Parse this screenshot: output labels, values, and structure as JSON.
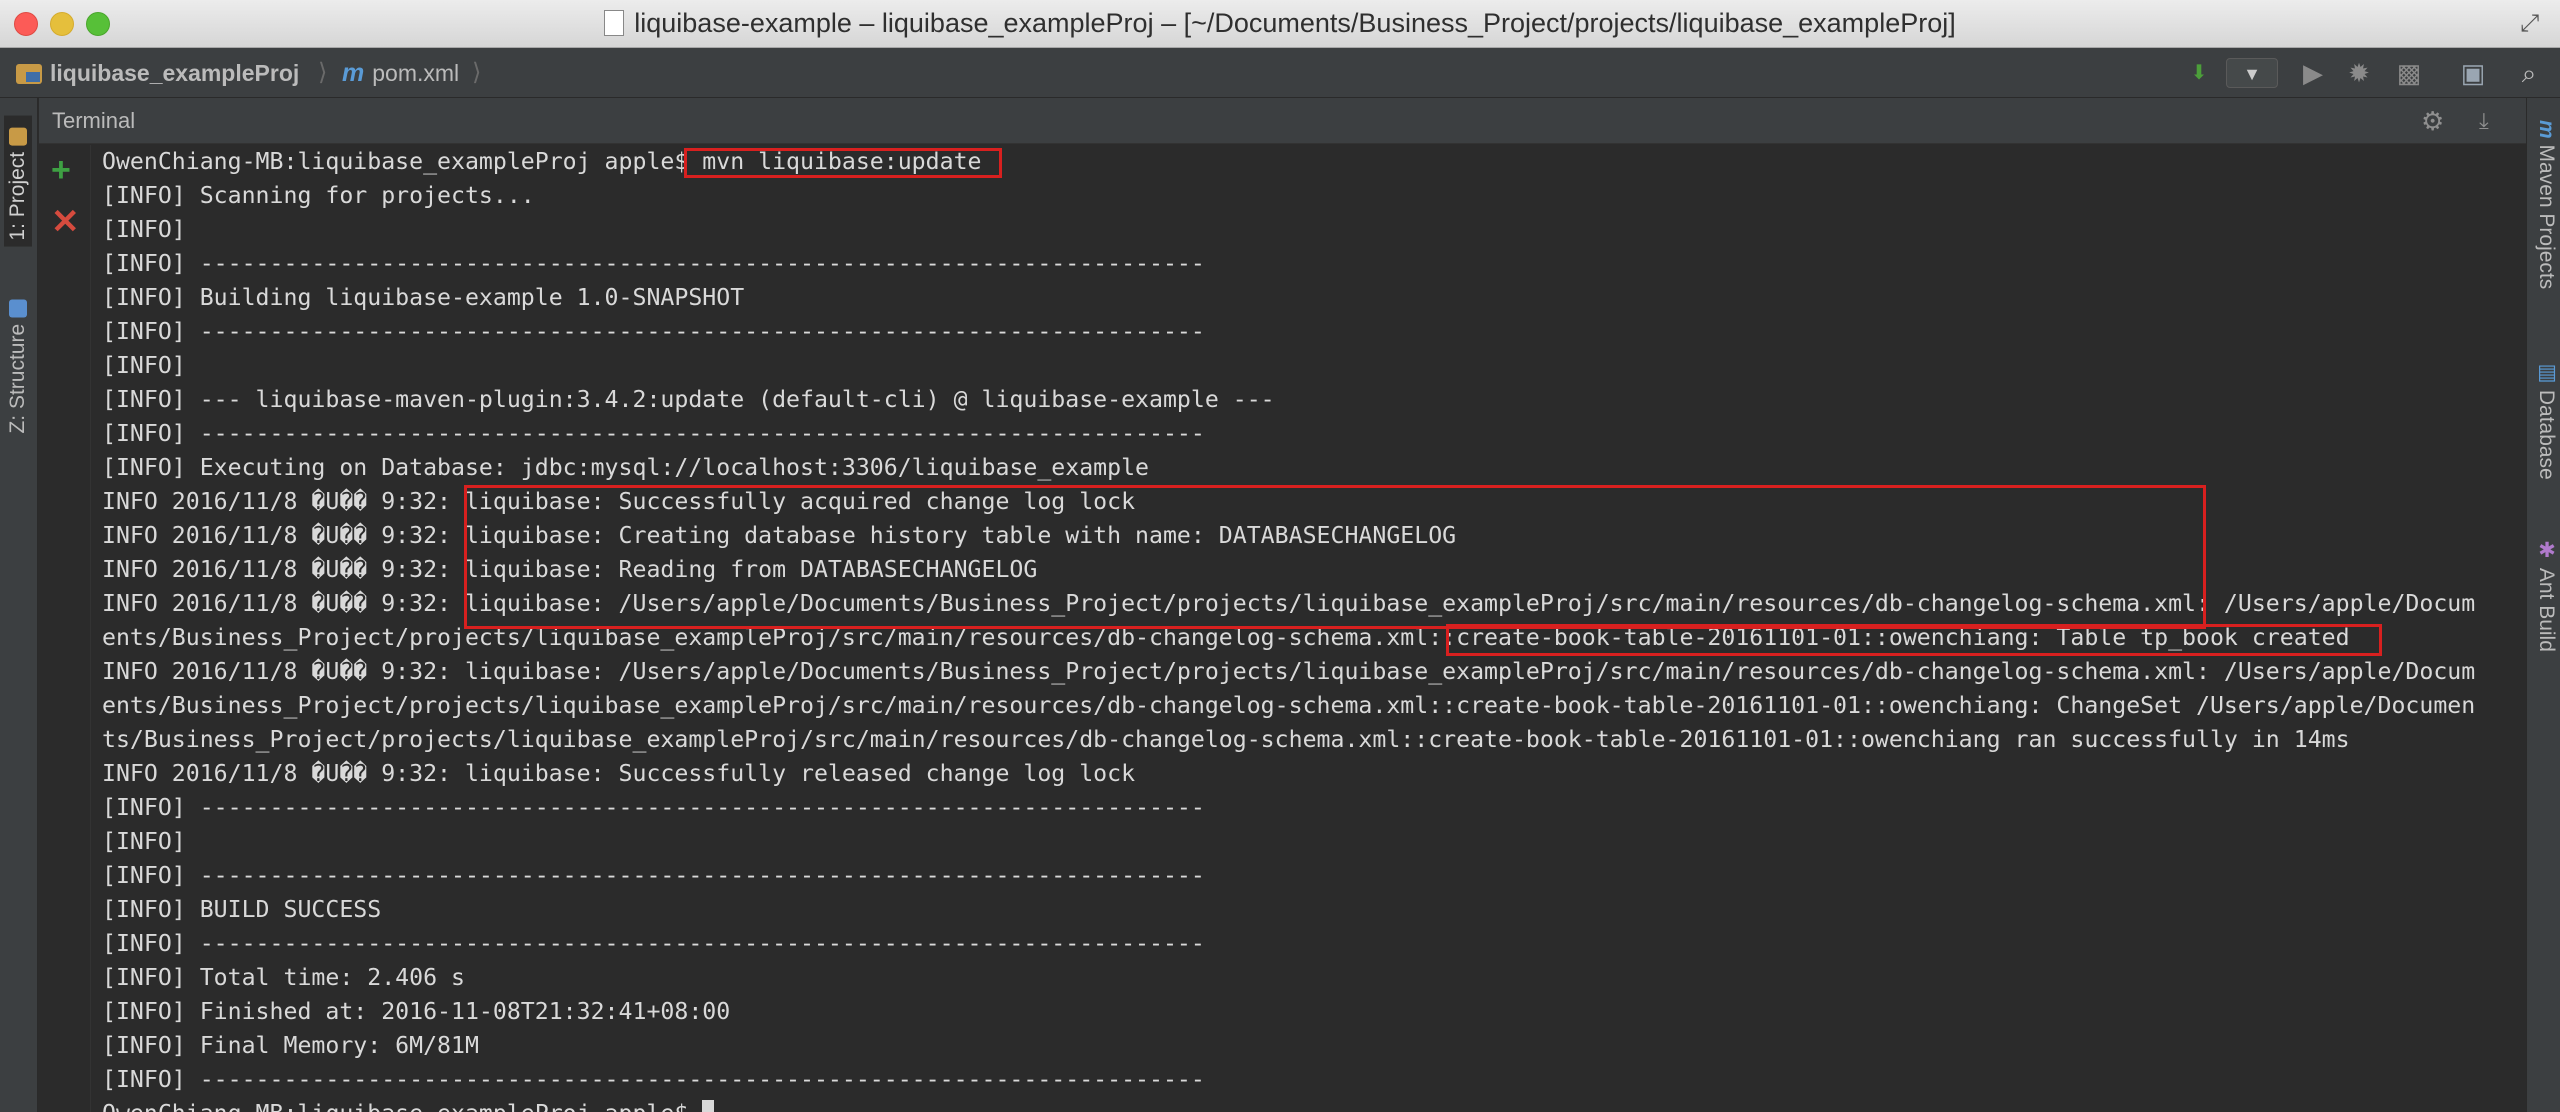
{
  "window": {
    "title": "liquibase-example – liquibase_exampleProj – [~/Documents/Business_Project/projects/liquibase_exampleProj]"
  },
  "navbar": {
    "project": "liquibase_exampleProj",
    "file": "pom.xml"
  },
  "left_tabs": {
    "project": "1: Project",
    "structure": "Z: Structure"
  },
  "right_tabs": {
    "maven": "Maven Projects",
    "database": "Database",
    "ant": "Ant Build"
  },
  "terminal": {
    "title": "Terminal",
    "prompt_line": "OwenChiang-MB:liquibase_exampleProj apple$ mvn liquibase:update",
    "lines": [
      "[INFO] Scanning for projects...",
      "[INFO]",
      "[INFO] ------------------------------------------------------------------------",
      "[INFO] Building liquibase-example 1.0-SNAPSHOT",
      "[INFO] ------------------------------------------------------------------------",
      "[INFO]",
      "[INFO] --- liquibase-maven-plugin:3.4.2:update (default-cli) @ liquibase-example ---",
      "[INFO] ------------------------------------------------------------------------",
      "[INFO] Executing on Database: jdbc:mysql://localhost:3306/liquibase_example",
      "INFO 2016/11/8 �U�� 9:32: liquibase: Successfully acquired change log lock",
      "INFO 2016/11/8 �U�� 9:32: liquibase: Creating database history table with name: DATABASECHANGELOG",
      "INFO 2016/11/8 �U�� 9:32: liquibase: Reading from DATABASECHANGELOG",
      "INFO 2016/11/8 �U�� 9:32: liquibase: /Users/apple/Documents/Business_Project/projects/liquibase_exampleProj/src/main/resources/db-changelog-schema.xml: /Users/apple/Docum",
      "ents/Business_Project/projects/liquibase_exampleProj/src/main/resources/db-changelog-schema.xml::create-book-table-20161101-01::owenchiang: Table tp_book created",
      "INFO 2016/11/8 �U�� 9:32: liquibase: /Users/apple/Documents/Business_Project/projects/liquibase_exampleProj/src/main/resources/db-changelog-schema.xml: /Users/apple/Docum",
      "ents/Business_Project/projects/liquibase_exampleProj/src/main/resources/db-changelog-schema.xml::create-book-table-20161101-01::owenchiang: ChangeSet /Users/apple/Documen",
      "ts/Business_Project/projects/liquibase_exampleProj/src/main/resources/db-changelog-schema.xml::create-book-table-20161101-01::owenchiang ran successfully in 14ms",
      "INFO 2016/11/8 �U�� 9:32: liquibase: Successfully released change log lock",
      "[INFO] ------------------------------------------------------------------------",
      "[INFO]",
      "[INFO] ------------------------------------------------------------------------",
      "[INFO] BUILD SUCCESS",
      "[INFO] ------------------------------------------------------------------------",
      "[INFO] Total time: 2.406 s",
      "[INFO] Finished at: 2016-11-08T21:32:41+08:00",
      "[INFO] Final Memory: 6M/81M",
      "[INFO] ------------------------------------------------------------------------"
    ],
    "last_prompt": "OwenChiang-MB:liquibase_exampleProj apple$ "
  },
  "icons": {
    "add": "plus-icon",
    "close": "close-icon",
    "settings": "gear-icon",
    "hide": "hide-icon"
  },
  "colors": {
    "highlight": "#d8201f",
    "background": "#2b2b2b",
    "text": "#d9d9d9",
    "add_green": "#3ea043",
    "close_red": "#d64b3e"
  }
}
